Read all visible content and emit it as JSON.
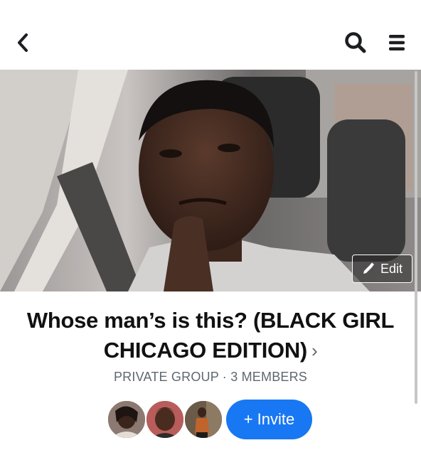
{
  "header": {
    "back_icon": "chevron-left-icon",
    "search_icon": "search-icon",
    "menu_icon": "menu-icon"
  },
  "cover": {
    "edit_label": "Edit",
    "edit_icon": "pencil-icon"
  },
  "group": {
    "title": "Whose man’s is this? (BLACK GIRL CHICAGO EDITION)",
    "chevron": "›",
    "meta": "PRIVATE GROUP · 3 MEMBERS"
  },
  "members": {
    "avatar_count": 3,
    "invite_label": "+ Invite"
  },
  "colors": {
    "accent": "#1877f2",
    "meta_text": "#606770",
    "title_text": "#111111"
  }
}
